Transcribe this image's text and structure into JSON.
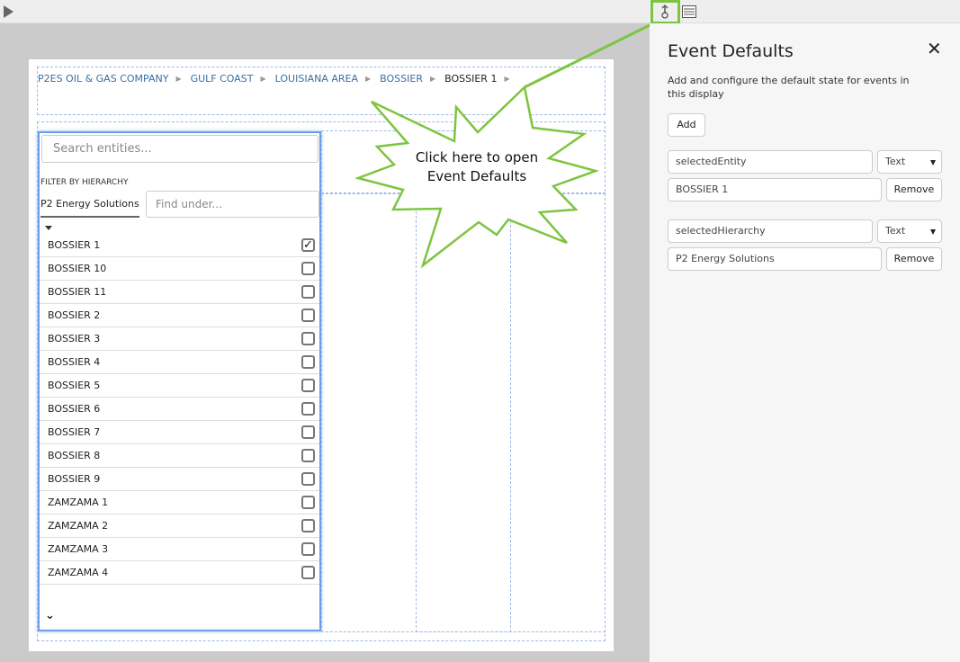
{
  "toolbar": {
    "play_icon": "play-icon",
    "event_defaults_icon": "event-defaults-icon",
    "list_icon": "list-icon"
  },
  "breadcrumb": [
    "P2ES OIL & GAS COMPANY",
    "GULF COAST",
    "LOUISIANA AREA",
    "BOSSIER",
    "BOSSIER 1"
  ],
  "entity_picker": {
    "search_placeholder": "Search entities...",
    "filter_label": "FILTER BY HIERARCHY",
    "hierarchy": "P2 Energy Solutions",
    "find_placeholder": "Find under...",
    "items": [
      {
        "label": "BOSSIER 1",
        "checked": true
      },
      {
        "label": "BOSSIER 10",
        "checked": false
      },
      {
        "label": "BOSSIER 11",
        "checked": false
      },
      {
        "label": "BOSSIER 2",
        "checked": false
      },
      {
        "label": "BOSSIER 3",
        "checked": false
      },
      {
        "label": "BOSSIER 4",
        "checked": false
      },
      {
        "label": "BOSSIER 5",
        "checked": false
      },
      {
        "label": "BOSSIER 6",
        "checked": false
      },
      {
        "label": "BOSSIER 7",
        "checked": false
      },
      {
        "label": "BOSSIER 8",
        "checked": false
      },
      {
        "label": "BOSSIER 9",
        "checked": false
      },
      {
        "label": "ZAMZAMA 1",
        "checked": false
      },
      {
        "label": "ZAMZAMA 2",
        "checked": false
      },
      {
        "label": "ZAMZAMA 3",
        "checked": false
      },
      {
        "label": "ZAMZAMA 4",
        "checked": false
      }
    ],
    "checkmark": "✓"
  },
  "callout": {
    "line1": "Click here to open",
    "line2": "Event Defaults",
    "color": "#7dc540"
  },
  "panel": {
    "title": "Event Defaults",
    "close": "✕",
    "description": "Add and configure the default state for events in this display",
    "add_label": "Add",
    "events": [
      {
        "name": "selectedEntity",
        "type": "Text",
        "value": "BOSSIER 1",
        "remove_label": "Remove"
      },
      {
        "name": "selectedHierarchy",
        "type": "Text",
        "value": "P2 Energy Solutions",
        "remove_label": "Remove"
      }
    ]
  }
}
